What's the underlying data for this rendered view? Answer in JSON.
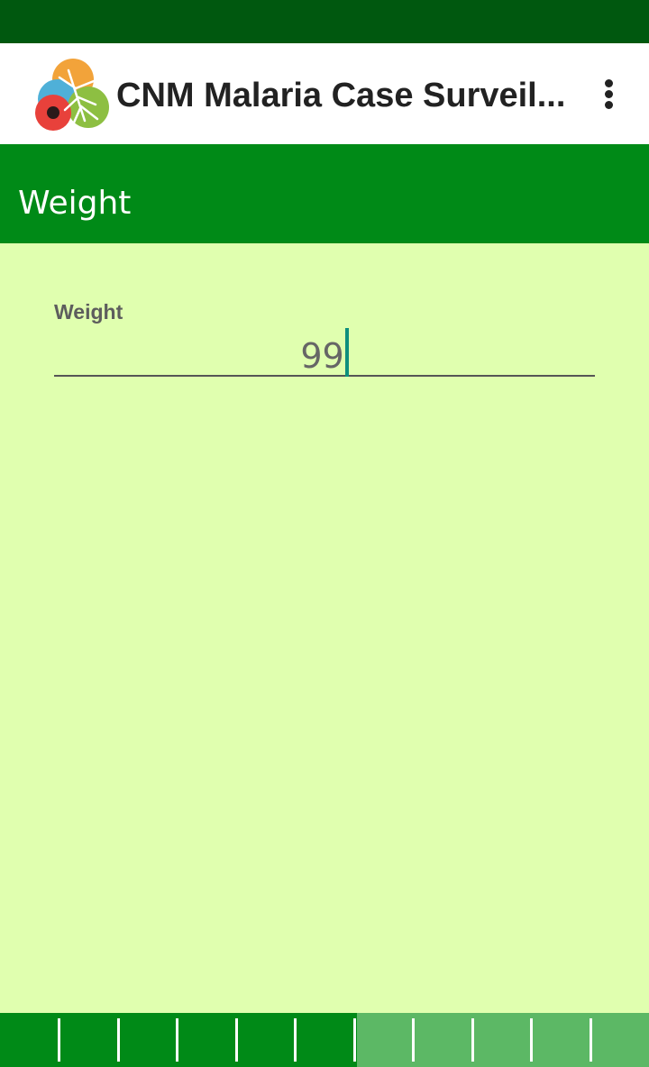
{
  "app_bar": {
    "title": "CNM Malaria Case Surveil...",
    "logo_icon": "malaria-mosquito-logo",
    "menu_icon": "more-vert-icon"
  },
  "section": {
    "title": "Weight"
  },
  "form": {
    "weight_label": "Weight",
    "weight_value": "99"
  },
  "progress": {
    "segments_total": 11,
    "segments_completed": 6,
    "fraction_completed": 0.55
  },
  "colors": {
    "status_bar": "#00580f",
    "header": "#008a17",
    "background": "#e0ffaf",
    "progress_done": "#008a17",
    "progress_todo": "#5cb865",
    "caret": "#0e8f7d"
  }
}
